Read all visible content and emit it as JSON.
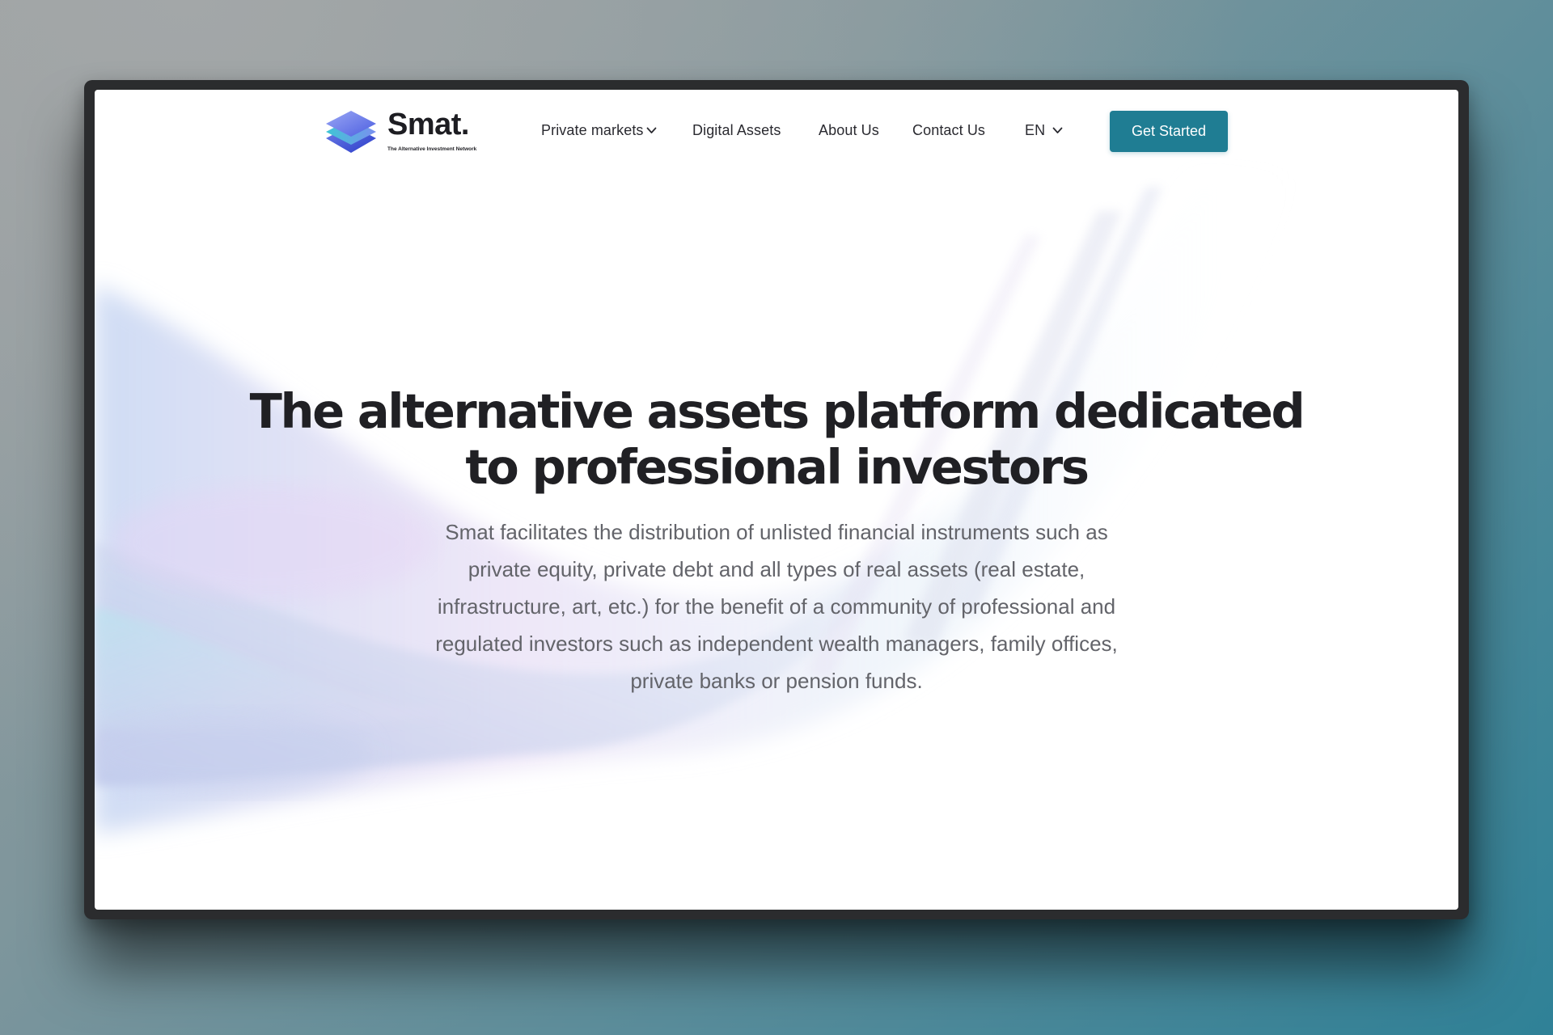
{
  "brand": {
    "name": "Smat.",
    "tagline": "The Alternative Investment Network",
    "logo_icon": "layered-diamond-icon"
  },
  "nav": {
    "items": [
      {
        "label": "Private markets",
        "has_dropdown": true
      },
      {
        "label": "Digital Assets"
      },
      {
        "label": "About Us"
      },
      {
        "label": "Contact Us"
      }
    ],
    "language": {
      "selected": "EN",
      "icon": "chevron-down-icon"
    },
    "cta_label": "Get Started"
  },
  "hero": {
    "title_line1": "The alternative assets platform dedicated",
    "title_line2": "to professional investors",
    "description": "Smat facilitates the distribution of unlisted financial instruments such as private equity, private debt and all types of real assets (real estate, infrastructure, art, etc.) for the benefit of a community of professional and regulated investors such as independent wealth managers, family offices, private banks or pension funds."
  },
  "colors": {
    "accent": "#1f7d93",
    "heading": "#202024",
    "body_text": "#63646a",
    "logo_blue": "#2b3ec9",
    "logo_cyan": "#3fc6d4"
  }
}
